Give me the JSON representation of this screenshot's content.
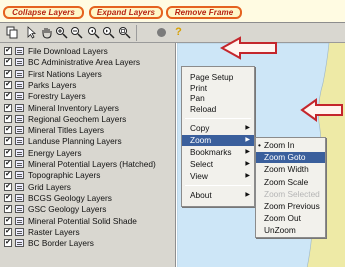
{
  "top_buttons": [
    "Collapse Layers",
    "Expand Layers",
    "Remove Frame"
  ],
  "toolbar": {
    "tools": [
      "copy-icon",
      "arrow-select-icon",
      "pan-hand-icon",
      "zoom-in-icon",
      "zoom-out-icon",
      "zoom-previous-icon",
      "zoom-next-icon",
      "zoom-extent-icon",
      "stop-icon",
      "help-icon"
    ]
  },
  "layers": [
    "File Download Layers",
    "BC Administrative Area Layers",
    "First Nations Layers",
    "Parks Layers",
    "Forestry Layers",
    "Mineral Inventory Layers",
    "Regional Geochem Layers",
    "Mineral Titles Layers",
    "Landuse Planning Layers",
    "Energy Layers",
    "Mineral Potential Layers (Hatched)",
    "Topographic Layers",
    "Grid Layers",
    "BCGS Geology Layers",
    "GSC Geology Layers",
    "Mineral Potential Solid Shade",
    "Raster Layers",
    "BC Border Layers"
  ],
  "context_menu": {
    "group1": [
      "Page Setup",
      "Print",
      "Pan",
      "Reload"
    ],
    "group2": [
      "Copy",
      "Zoom",
      "Bookmarks",
      "Select",
      "View"
    ],
    "group3": [
      "About"
    ],
    "highlighted": "Zoom"
  },
  "zoom_submenu": {
    "items": [
      "Zoom In",
      "Zoom Goto",
      "Zoom Width",
      "Zoom Scale",
      "Zoom Selected",
      "Zoom Previous",
      "Zoom Out",
      "UnZoom"
    ],
    "checked": "Zoom In",
    "highlighted": "Zoom Goto",
    "disabled": "Zoom Selected"
  },
  "colors": {
    "map_land": "#eeeaa6",
    "map_water": "#cde6f7",
    "highlight": "#3a5f9c",
    "button_border": "#e5621f",
    "pointer_arrow": "#c4262c"
  }
}
